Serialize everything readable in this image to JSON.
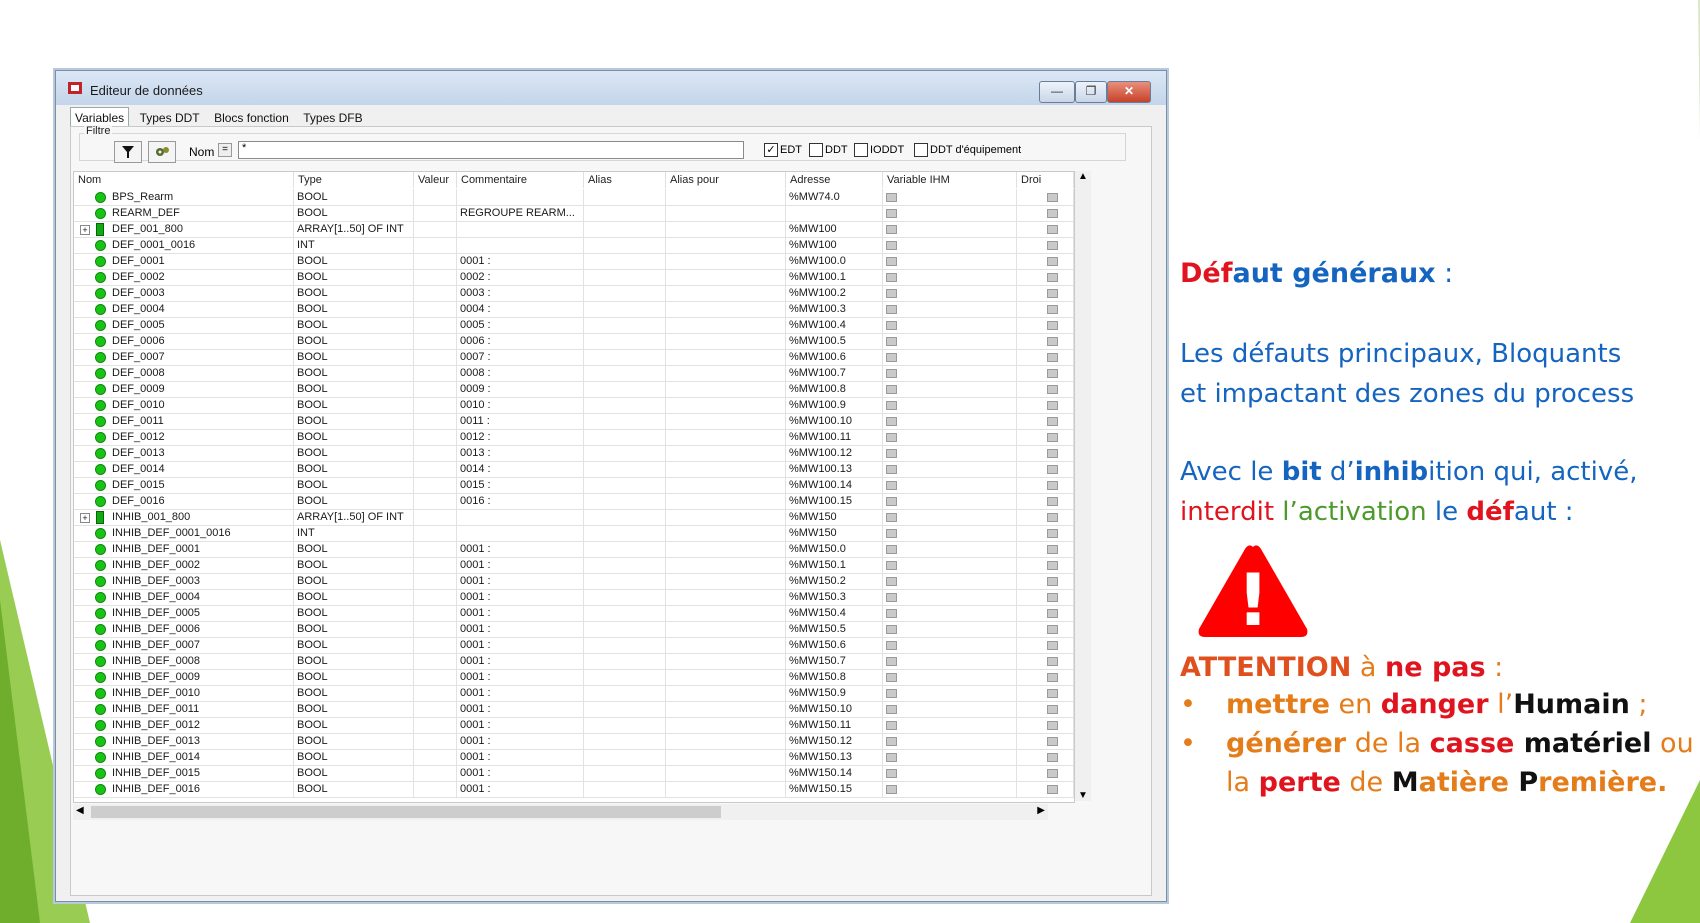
{
  "window": {
    "title": "Editeur de données",
    "min": "—",
    "max": "❐",
    "close": "✕"
  },
  "tabs": [
    "Variables",
    "Types DDT",
    "Blocs fonction",
    "Types DFB"
  ],
  "filter": {
    "label": "Filtre",
    "nom_label": "Nom",
    "eq": "=",
    "value": "*",
    "checks": [
      {
        "label": "EDT",
        "checked": true
      },
      {
        "label": "DDT",
        "checked": false
      },
      {
        "label": "IODDT",
        "checked": false
      },
      {
        "label": "DDT d'équipement",
        "checked": false
      }
    ]
  },
  "columns": [
    "Nom",
    "Type",
    "Valeur",
    "Commentaire",
    "Alias",
    "Alias pour",
    "Adresse",
    "Variable IHM",
    "Droi"
  ],
  "rows": [
    {
      "name": "BPS_Rearm",
      "type": "BOOL",
      "comment": "",
      "addr": "%MW74.0",
      "kind": "bool",
      "expand": false
    },
    {
      "name": "REARM_DEF",
      "type": "BOOL",
      "comment": "REGROUPE REARM...",
      "addr": "",
      "kind": "bool",
      "expand": false
    },
    {
      "name": "DEF_001_800",
      "type": "ARRAY[1..50] OF INT",
      "comment": "",
      "addr": "%MW100",
      "kind": "array",
      "expand": true
    },
    {
      "name": "DEF_0001_0016",
      "type": "INT",
      "comment": "",
      "addr": "%MW100",
      "kind": "bool",
      "expand": false
    },
    {
      "name": "DEF_0001",
      "type": "BOOL",
      "comment": "0001 :",
      "addr": "%MW100.0",
      "kind": "bool",
      "expand": false
    },
    {
      "name": "DEF_0002",
      "type": "BOOL",
      "comment": "0002 :",
      "addr": "%MW100.1",
      "kind": "bool",
      "expand": false
    },
    {
      "name": "DEF_0003",
      "type": "BOOL",
      "comment": "0003 :",
      "addr": "%MW100.2",
      "kind": "bool",
      "expand": false
    },
    {
      "name": "DEF_0004",
      "type": "BOOL",
      "comment": "0004 :",
      "addr": "%MW100.3",
      "kind": "bool",
      "expand": false
    },
    {
      "name": "DEF_0005",
      "type": "BOOL",
      "comment": "0005 :",
      "addr": "%MW100.4",
      "kind": "bool",
      "expand": false
    },
    {
      "name": "DEF_0006",
      "type": "BOOL",
      "comment": "0006 :",
      "addr": "%MW100.5",
      "kind": "bool",
      "expand": false
    },
    {
      "name": "DEF_0007",
      "type": "BOOL",
      "comment": "0007 :",
      "addr": "%MW100.6",
      "kind": "bool",
      "expand": false
    },
    {
      "name": "DEF_0008",
      "type": "BOOL",
      "comment": "0008 :",
      "addr": "%MW100.7",
      "kind": "bool",
      "expand": false
    },
    {
      "name": "DEF_0009",
      "type": "BOOL",
      "comment": "0009 :",
      "addr": "%MW100.8",
      "kind": "bool",
      "expand": false
    },
    {
      "name": "DEF_0010",
      "type": "BOOL",
      "comment": "0010 :",
      "addr": "%MW100.9",
      "kind": "bool",
      "expand": false
    },
    {
      "name": "DEF_0011",
      "type": "BOOL",
      "comment": "0011 :",
      "addr": "%MW100.10",
      "kind": "bool",
      "expand": false
    },
    {
      "name": "DEF_0012",
      "type": "BOOL",
      "comment": "0012 :",
      "addr": "%MW100.11",
      "kind": "bool",
      "expand": false
    },
    {
      "name": "DEF_0013",
      "type": "BOOL",
      "comment": "0013 :",
      "addr": "%MW100.12",
      "kind": "bool",
      "expand": false
    },
    {
      "name": "DEF_0014",
      "type": "BOOL",
      "comment": "0014 :",
      "addr": "%MW100.13",
      "kind": "bool",
      "expand": false
    },
    {
      "name": "DEF_0015",
      "type": "BOOL",
      "comment": "0015 :",
      "addr": "%MW100.14",
      "kind": "bool",
      "expand": false
    },
    {
      "name": "DEF_0016",
      "type": "BOOL",
      "comment": "0016 :",
      "addr": "%MW100.15",
      "kind": "bool",
      "expand": false
    },
    {
      "name": "INHIB_001_800",
      "type": "ARRAY[1..50] OF INT",
      "comment": "",
      "addr": "%MW150",
      "kind": "array",
      "expand": true
    },
    {
      "name": "INHIB_DEF_0001_0016",
      "type": "INT",
      "comment": "",
      "addr": "%MW150",
      "kind": "bool",
      "expand": false
    },
    {
      "name": "INHIB_DEF_0001",
      "type": "BOOL",
      "comment": "0001 :",
      "addr": "%MW150.0",
      "kind": "bool",
      "expand": false
    },
    {
      "name": "INHIB_DEF_0002",
      "type": "BOOL",
      "comment": "0001 :",
      "addr": "%MW150.1",
      "kind": "bool",
      "expand": false
    },
    {
      "name": "INHIB_DEF_0003",
      "type": "BOOL",
      "comment": "0001 :",
      "addr": "%MW150.2",
      "kind": "bool",
      "expand": false
    },
    {
      "name": "INHIB_DEF_0004",
      "type": "BOOL",
      "comment": "0001 :",
      "addr": "%MW150.3",
      "kind": "bool",
      "expand": false
    },
    {
      "name": "INHIB_DEF_0005",
      "type": "BOOL",
      "comment": "0001 :",
      "addr": "%MW150.4",
      "kind": "bool",
      "expand": false
    },
    {
      "name": "INHIB_DEF_0006",
      "type": "BOOL",
      "comment": "0001 :",
      "addr": "%MW150.5",
      "kind": "bool",
      "expand": false
    },
    {
      "name": "INHIB_DEF_0007",
      "type": "BOOL",
      "comment": "0001 :",
      "addr": "%MW150.6",
      "kind": "bool",
      "expand": false
    },
    {
      "name": "INHIB_DEF_0008",
      "type": "BOOL",
      "comment": "0001 :",
      "addr": "%MW150.7",
      "kind": "bool",
      "expand": false
    },
    {
      "name": "INHIB_DEF_0009",
      "type": "BOOL",
      "comment": "0001 :",
      "addr": "%MW150.8",
      "kind": "bool",
      "expand": false
    },
    {
      "name": "INHIB_DEF_0010",
      "type": "BOOL",
      "comment": "0001 :",
      "addr": "%MW150.9",
      "kind": "bool",
      "expand": false
    },
    {
      "name": "INHIB_DEF_0011",
      "type": "BOOL",
      "comment": "0001 :",
      "addr": "%MW150.10",
      "kind": "bool",
      "expand": false
    },
    {
      "name": "INHIB_DEF_0012",
      "type": "BOOL",
      "comment": "0001 :",
      "addr": "%MW150.11",
      "kind": "bool",
      "expand": false
    },
    {
      "name": "INHIB_DEF_0013",
      "type": "BOOL",
      "comment": "0001 :",
      "addr": "%MW150.12",
      "kind": "bool",
      "expand": false
    },
    {
      "name": "INHIB_DEF_0014",
      "type": "BOOL",
      "comment": "0001 :",
      "addr": "%MW150.13",
      "kind": "bool",
      "expand": false
    },
    {
      "name": "INHIB_DEF_0015",
      "type": "BOOL",
      "comment": "0001 :",
      "addr": "%MW150.14",
      "kind": "bool",
      "expand": false
    },
    {
      "name": "INHIB_DEF_0016",
      "type": "BOOL",
      "comment": "0001 :",
      "addr": "%MW150.15",
      "kind": "bool",
      "expand": false
    }
  ],
  "slide": {
    "heading": {
      "p1": "Déf",
      "p2": "aut généraux",
      "p3": " :"
    },
    "para1": {
      "line1": "Les défauts principaux, Bloquants",
      "line2": "et impactant des zones du process"
    },
    "para2": {
      "a": "Avec le ",
      "b": "bit",
      "c": " d’",
      "d": "inhib",
      "e": "ition qui, activé,",
      "f": "interdit",
      "g": " l’",
      "h": "activation",
      "i": " le ",
      "j": "déf",
      "k": "aut :"
    },
    "warning_glyph": "!",
    "attention": {
      "a": "ATTENTION",
      "b": " à ",
      "c": "ne pas",
      "d": " :"
    },
    "bullet_glyph": "•",
    "bullet1": {
      "a": "mettre",
      "b": " en ",
      "c": "danger",
      "d": " l’",
      "e": "Humain",
      "f": " ;"
    },
    "bullet2": {
      "a": "générer",
      "b": " de la ",
      "c": "casse",
      "d": " matériel",
      "e": " ou",
      "f": "la ",
      "g": "perte",
      "h": " de ",
      "i": "M",
      "j": "atière ",
      "k": "P",
      "l": "remière."
    },
    "colors": {
      "red": "#e0141e",
      "blue": "#1565c0",
      "green": "#4c9a2a",
      "orange": "#e57c1a",
      "decor_green": "#8dc63f"
    }
  }
}
